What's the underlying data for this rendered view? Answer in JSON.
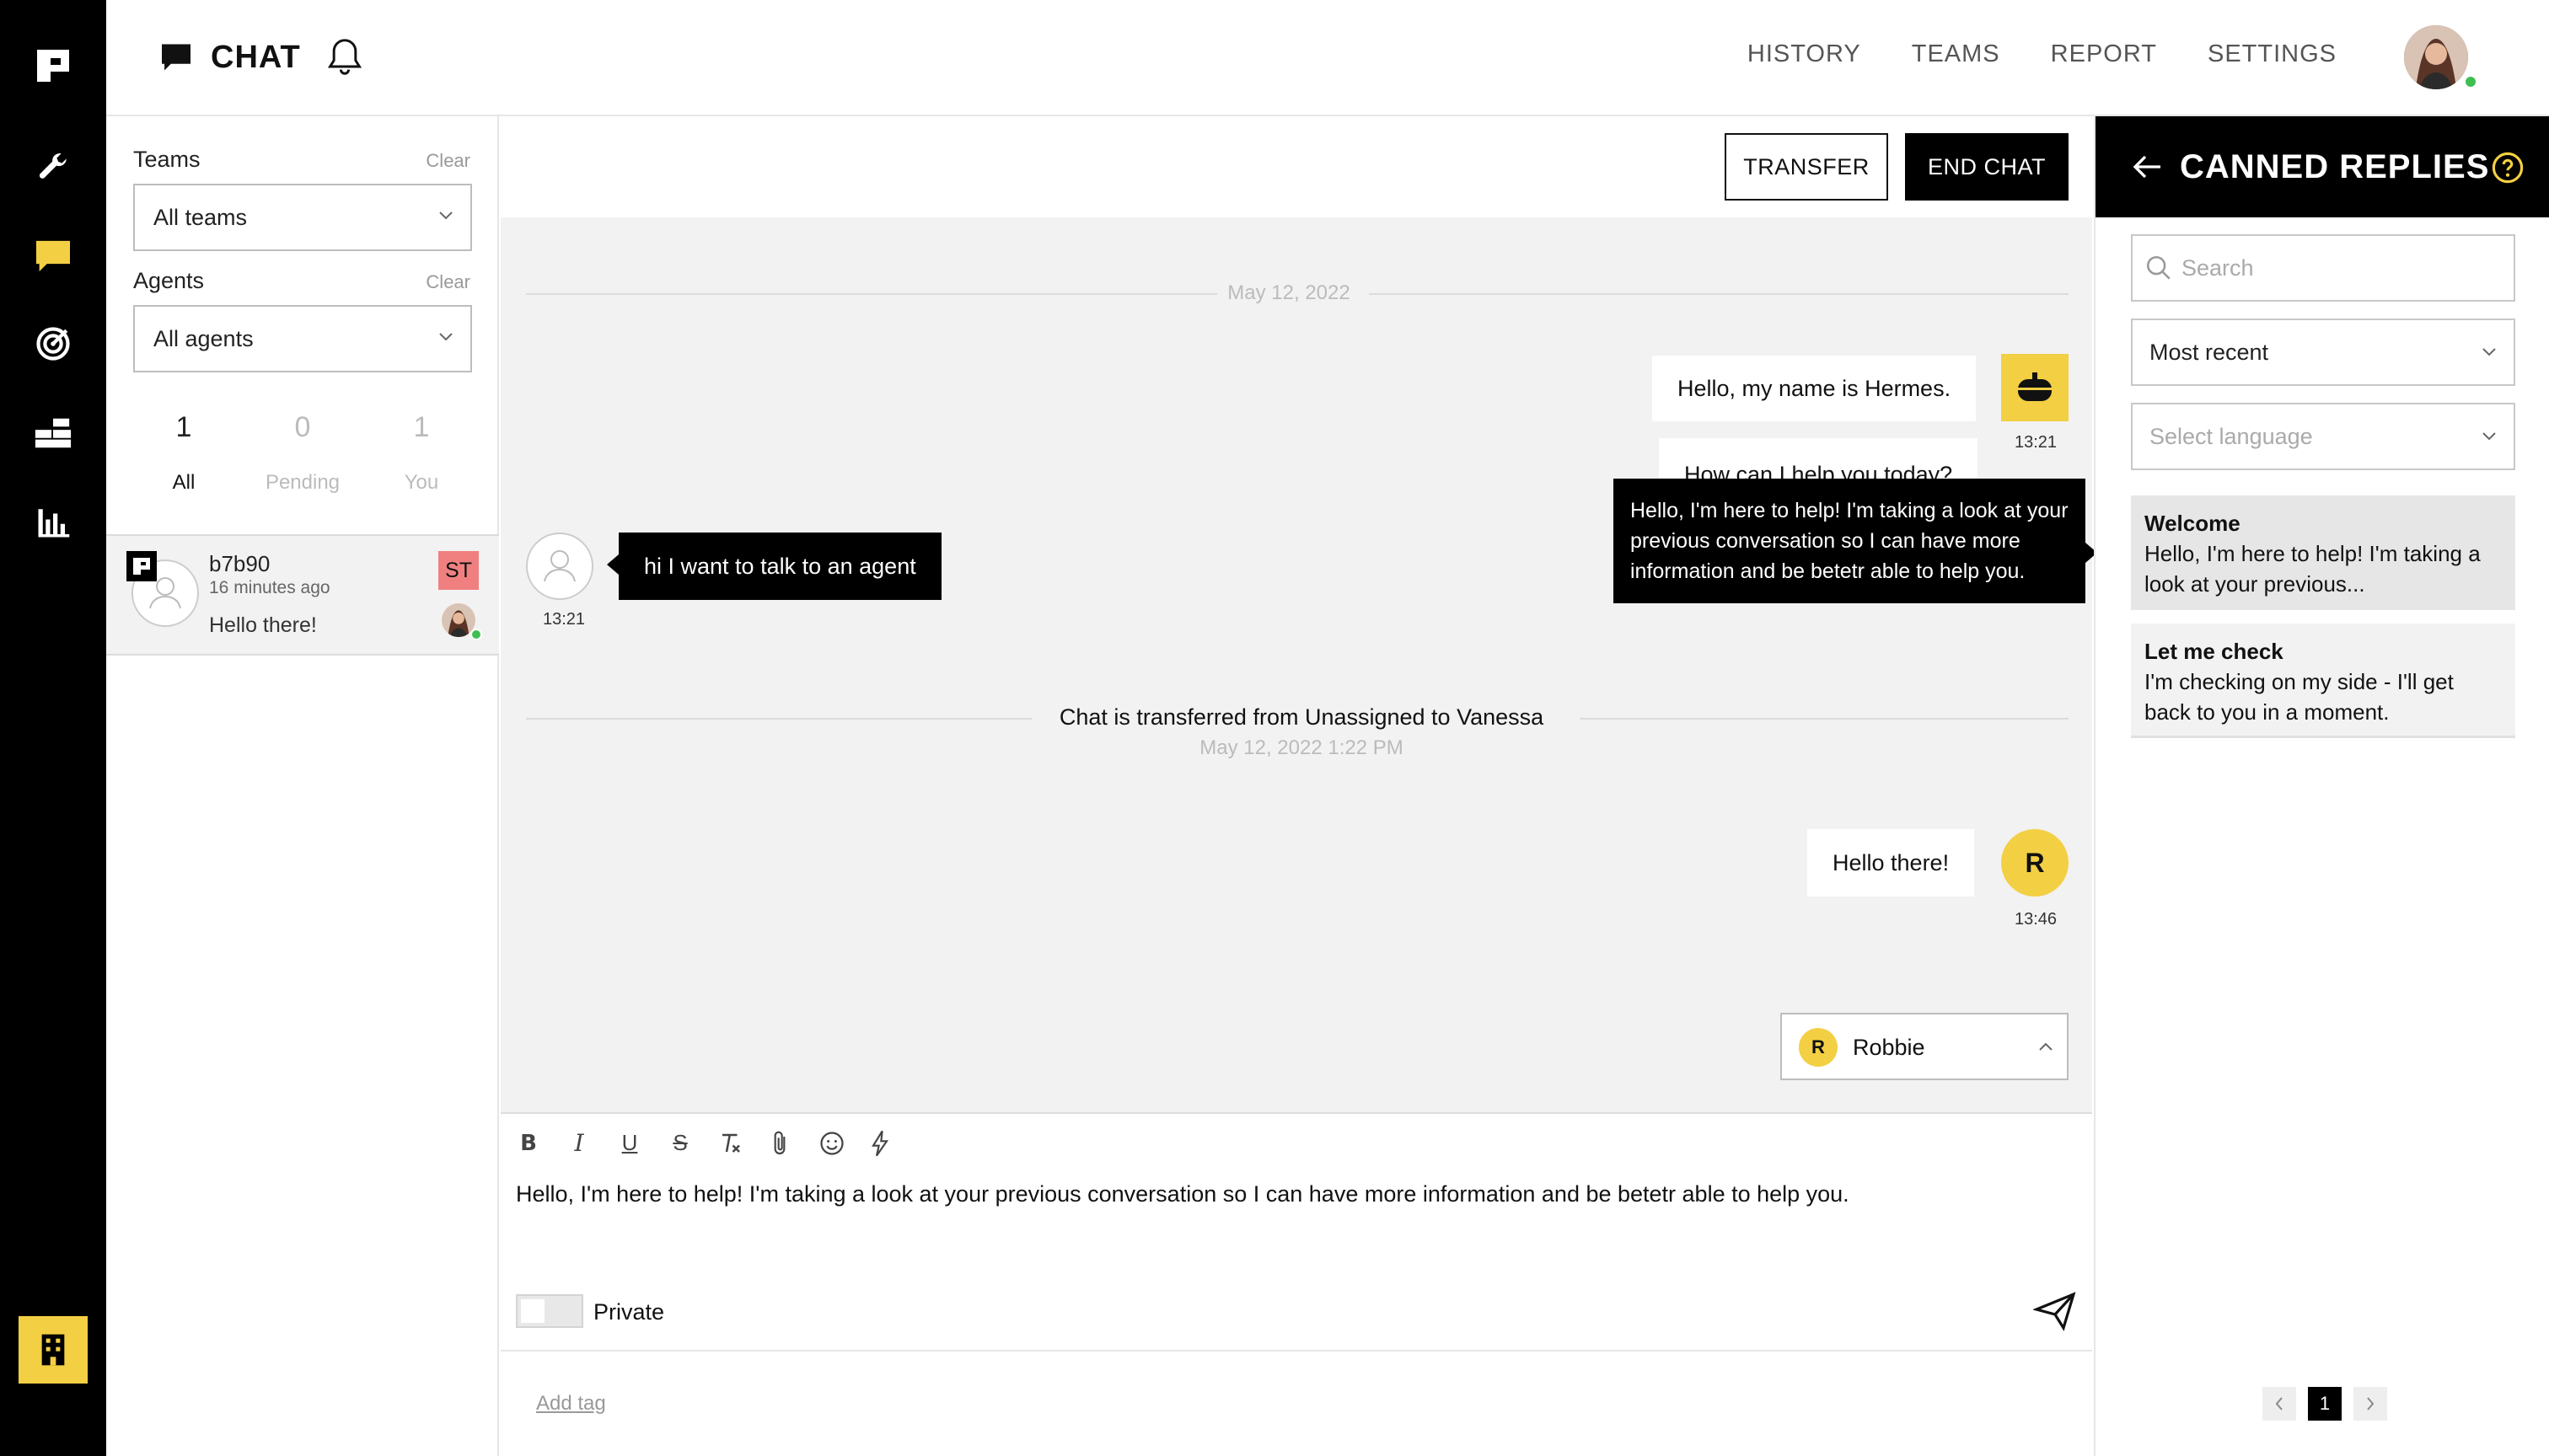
{
  "header": {
    "title": "CHAT",
    "nav": [
      "HISTORY",
      "TEAMS",
      "REPORT",
      "SETTINGS"
    ]
  },
  "filters": {
    "teams_label": "Teams",
    "teams_clear": "Clear",
    "teams_value": "All teams",
    "agents_label": "Agents",
    "agents_clear": "Clear",
    "agents_value": "All agents",
    "counts": [
      {
        "n": "1",
        "label": "All"
      },
      {
        "n": "0",
        "label": "Pending"
      },
      {
        "n": "1",
        "label": "You"
      }
    ]
  },
  "conversation": {
    "id": "b7b90",
    "time": "16 minutes ago",
    "preview": "Hello there!",
    "badge": "ST"
  },
  "chat": {
    "transfer_label": "TRANSFER",
    "end_label": "END CHAT",
    "date_divider": "May 12, 2022",
    "bot_msg_1": "Hello, my name is Hermes.",
    "bot_msg_2": "How can I help you today?",
    "bot_time": "13:21",
    "user_msg": "hi I want to talk to an agent",
    "user_time": "13:21",
    "tooltip": "Hello, I'm here to help! I'm taking a look at your previous conversation so I can have more information and be betetr able to help you.",
    "transfer_note": "Chat is transferred from Unassigned to Vanessa",
    "transfer_date": "May 12, 2022 1:22 PM",
    "agent_msg": "Hello there!",
    "agent_initial": "R",
    "agent_time": "13:46",
    "sender_initial": "R",
    "sender_name": "Robbie"
  },
  "composer": {
    "text": "Hello, I'm here to help! I'm taking a look at your previous conversation so I can have more information and be betetr able to help you.",
    "private_label": "Private",
    "add_tag": "Add tag"
  },
  "canned": {
    "title": "CANNED REPLIES",
    "search_placeholder": "Search",
    "sort_value": "Most recent",
    "language_placeholder": "Select language",
    "replies": [
      {
        "title": "Welcome",
        "body": "Hello, I'm here to help! I'm taking a look at your previous..."
      },
      {
        "title": "Let me check",
        "body": "I'm checking on my side - I'll get back to you in a moment."
      }
    ],
    "page": "1"
  },
  "colors": {
    "accent": "#f3cf43",
    "rail": "#000000",
    "badge": "#f08080",
    "online": "#3fbf52"
  }
}
